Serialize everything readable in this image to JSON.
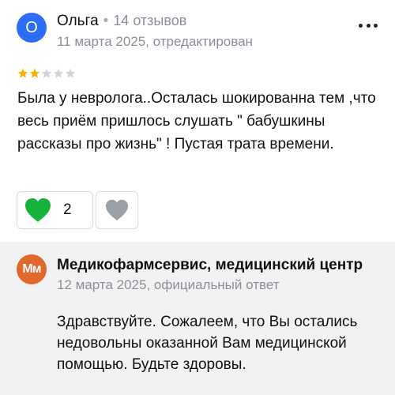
{
  "review": {
    "author_initial": "О",
    "author_name": "Ольга",
    "separator": "•",
    "reviews_count": "14 отзывов",
    "date": "11 марта 2025, отредактирован",
    "rating": 2,
    "rating_max": 5,
    "text": "Была у невролога..Осталась шокированна тем ,что весь приём пришлось слушать \" бабушкины рассказы про жизнь\" ! Пустая трата времени.",
    "likes": "2",
    "colors": {
      "avatar": "#2d6cf6",
      "star_filled": "#f5b301",
      "star_empty": "#d0d3d8",
      "like_heart": "#16b33a",
      "dislike_heart": "#9aa0a6"
    }
  },
  "reply": {
    "org_initials": "Мм",
    "org_name": "Медикофармсервис, медицинский центр",
    "meta": "12 марта 2025, официальный ответ",
    "text": "Здравствуйте. Сожалеем, что Вы остались недовольны оказанной Вам медицинской помощью. Будьте здоровы.",
    "colors": {
      "avatar": "#e2672a",
      "background": "#f2f2f2"
    }
  },
  "icons": {
    "more": "more-options-icon",
    "like": "heart-icon",
    "dislike": "heart-icon",
    "star": "star-icon"
  }
}
